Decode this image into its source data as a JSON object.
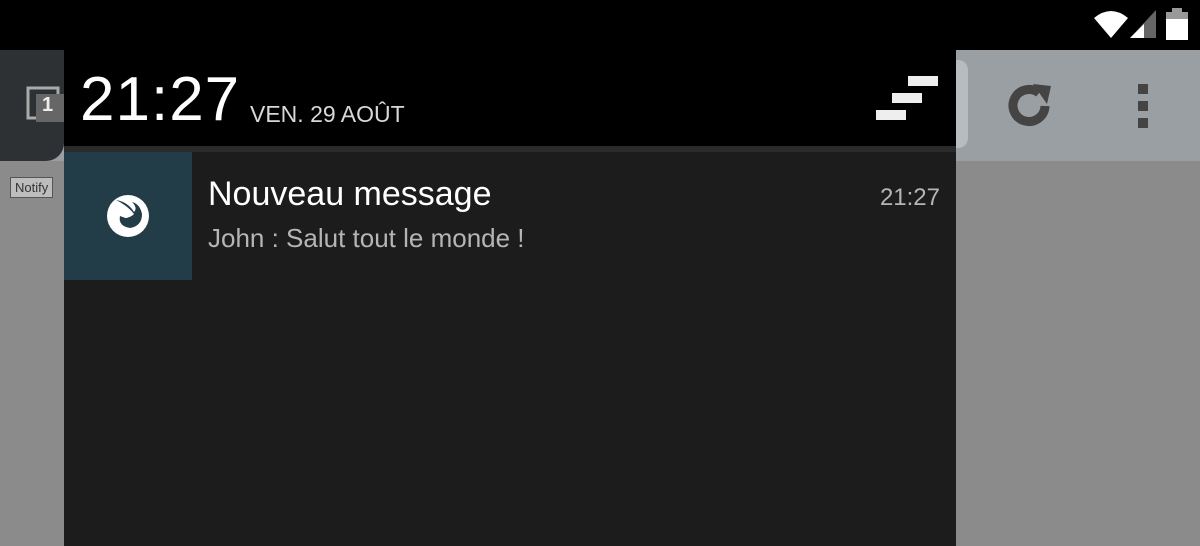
{
  "status_bar": {
    "icons": [
      "wifi-icon",
      "signal-icon",
      "battery-icon"
    ]
  },
  "browser": {
    "tabs_count": "1",
    "notify_button_label": "Notify",
    "icons": [
      "tabs-icon",
      "reload-icon",
      "overflow-menu-icon"
    ]
  },
  "shade": {
    "clock": "21:27",
    "date": "VEN. 29 AOÛT",
    "clear_all_icon": "clear-all-icon"
  },
  "notification": {
    "app_icon": "firefox-icon",
    "title": "Nouveau message",
    "text": "John : Salut tout le monde !",
    "time": "21:27",
    "icon_bg": "#223d48"
  }
}
